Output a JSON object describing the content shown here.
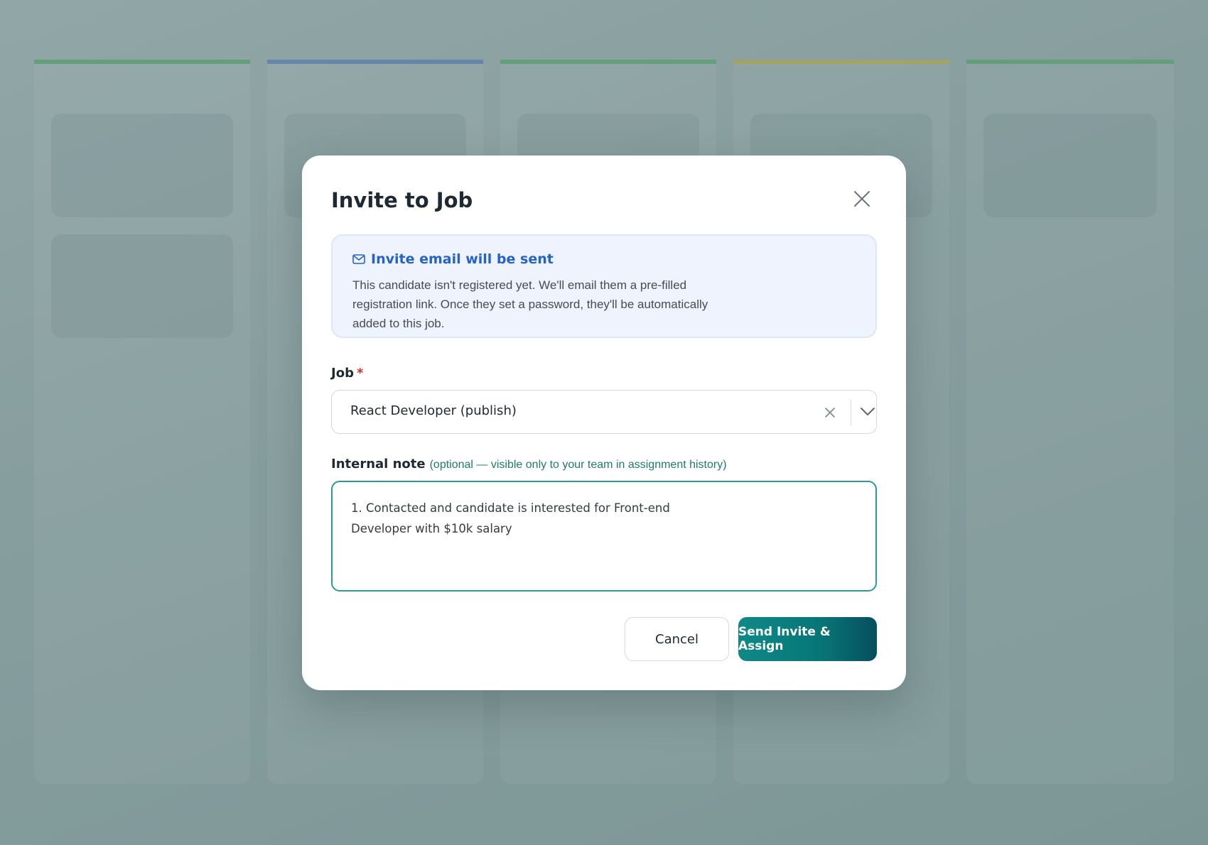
{
  "board": {
    "column_colors": [
      "#5aa36d",
      "#5b7fb6",
      "#5aa36d",
      "#b9ad4d",
      "#5aa36d"
    ]
  },
  "modal": {
    "title": "Invite to Job",
    "close_icon": "close-icon",
    "info": {
      "icon": "mail-icon",
      "title": "Invite email will be sent",
      "text": "This candidate isn't registered yet. We'll email them a pre-filled registration link. Once they set a password, they'll be automatically added to this job."
    },
    "job_field": {
      "label": "Job",
      "required_marker": "*",
      "value": "React Developer (publish)",
      "clear_icon": "clear-icon",
      "dropdown_icon": "chevron-down-icon"
    },
    "note_field": {
      "label": "Internal note",
      "hint": "(optional — visible only to your team in assignment history)",
      "value": "1. Contacted and candidate is interested for Front-end\nDeveloper with $10k salary"
    },
    "actions": {
      "cancel_label": "Cancel",
      "submit_label": "Send Invite & Assign"
    },
    "colors": {
      "accent": "#0d8a88",
      "info_title": "#2563c9",
      "required": "#c0392b"
    }
  }
}
